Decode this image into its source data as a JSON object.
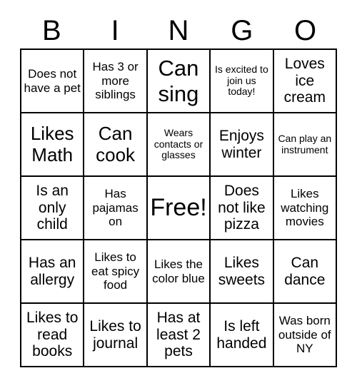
{
  "card": {
    "header_letters": [
      "B",
      "I",
      "N",
      "G",
      "O"
    ],
    "border_color": "#000000",
    "background_color": "#ffffff",
    "text_color": "#000000",
    "rows": 5,
    "columns": 5
  },
  "cells": [
    {
      "text": "Does not have a pet",
      "size": "sm"
    },
    {
      "text": "Has 3 or more siblings",
      "size": "sm"
    },
    {
      "text": "Can sing",
      "size": "xl"
    },
    {
      "text": "Is excited to join us today!",
      "size": "xs"
    },
    {
      "text": "Loves ice cream",
      "size": "md"
    },
    {
      "text": "Likes Math",
      "size": "lg"
    },
    {
      "text": "Can cook",
      "size": "lg"
    },
    {
      "text": "Wears contacts or glasses",
      "size": "xs"
    },
    {
      "text": "Enjoys winter",
      "size": "md"
    },
    {
      "text": "Can play an instrument",
      "size": "xs"
    },
    {
      "text": "Is an only child",
      "size": "md"
    },
    {
      "text": "Has pajamas on",
      "size": "sm"
    },
    {
      "text": "Free!",
      "size": "xxl"
    },
    {
      "text": "Does not like pizza",
      "size": "md"
    },
    {
      "text": "Likes watching movies",
      "size": "sm"
    },
    {
      "text": "Has an allergy",
      "size": "md"
    },
    {
      "text": "Likes to eat spicy food",
      "size": "sm"
    },
    {
      "text": "Likes the color blue",
      "size": "sm"
    },
    {
      "text": "Likes sweets",
      "size": "md"
    },
    {
      "text": "Can dance",
      "size": "md"
    },
    {
      "text": "Likes to read books",
      "size": "md"
    },
    {
      "text": "Likes to journal",
      "size": "md"
    },
    {
      "text": "Has at least 2 pets",
      "size": "md"
    },
    {
      "text": "Is left handed",
      "size": "md"
    },
    {
      "text": "Was born outside of NY",
      "size": "sm"
    }
  ]
}
